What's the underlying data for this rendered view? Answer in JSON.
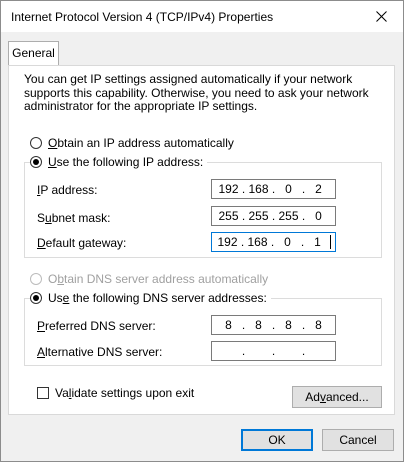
{
  "window": {
    "title": "Internet Protocol Version 4 (TCP/IPv4) Properties"
  },
  "tabs": [
    {
      "label": "General"
    }
  ],
  "description": "You can get IP settings assigned automatically if your network supports this capability. Otherwise, you need to ask your network administrator for the appropriate IP settings.",
  "ip_section": {
    "auto_option": {
      "pre": "",
      "mnemonic": "O",
      "post": "btain an IP address automatically"
    },
    "manual_option": {
      "pre": "",
      "mnemonic": "U",
      "post": "se the following IP address:"
    },
    "fields": [
      {
        "pre": "",
        "mnemonic": "I",
        "post": "P address:",
        "octets": [
          "192",
          "168",
          "0",
          "2"
        ]
      },
      {
        "pre": "S",
        "mnemonic": "u",
        "post": "bnet mask:",
        "octets": [
          "255",
          "255",
          "255",
          "0"
        ]
      },
      {
        "pre": "",
        "mnemonic": "D",
        "post": "efault gateway:",
        "octets": [
          "192",
          "168",
          "0",
          "1"
        ]
      }
    ]
  },
  "dns_section": {
    "auto_option": {
      "pre": "O",
      "mnemonic": "b",
      "post": "tain DNS server address automatically"
    },
    "manual_option": {
      "pre": "Us",
      "mnemonic": "e",
      "post": " the following DNS server addresses:"
    },
    "fields": [
      {
        "pre": "",
        "mnemonic": "P",
        "post": "referred DNS server:",
        "octets": [
          "8",
          "8",
          "8",
          "8"
        ]
      },
      {
        "pre": "",
        "mnemonic": "A",
        "post": "lternative DNS server:",
        "octets": [
          "",
          "",
          "",
          ""
        ]
      }
    ]
  },
  "validate": {
    "pre": "Va",
    "mnemonic": "l",
    "post": "idate settings upon exit",
    "checked": false
  },
  "buttons": {
    "advanced": {
      "pre": "Ad",
      "mnemonic": "v",
      "post": "anced..."
    },
    "ok": "OK",
    "cancel": "Cancel"
  },
  "icons": {
    "close": "close-icon"
  }
}
